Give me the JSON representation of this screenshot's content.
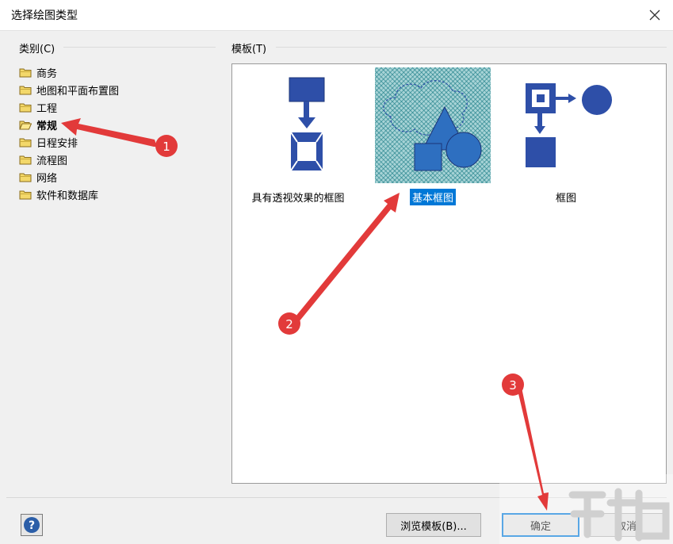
{
  "dialog": {
    "title": "选择绘图类型"
  },
  "categories": {
    "label": "类别(C)",
    "items": [
      {
        "label": "商务"
      },
      {
        "label": "地图和平面布置图"
      },
      {
        "label": "工程"
      },
      {
        "label": "常规"
      },
      {
        "label": "日程安排"
      },
      {
        "label": "流程图"
      },
      {
        "label": "网络"
      },
      {
        "label": "软件和数据库"
      }
    ]
  },
  "templates": {
    "label": "模板(T)",
    "items": [
      {
        "label": "具有透视效果的框图"
      },
      {
        "label": "基本框图"
      },
      {
        "label": "框图"
      }
    ]
  },
  "buttons": {
    "browse": "浏览模板(B)...",
    "ok": "确定",
    "cancel": "取消"
  },
  "annotations": [
    "1",
    "2",
    "3"
  ],
  "colors": {
    "accent": "#0078d7",
    "shape_blue": "#2e4fa8",
    "annotation_red": "#e23a3a"
  }
}
